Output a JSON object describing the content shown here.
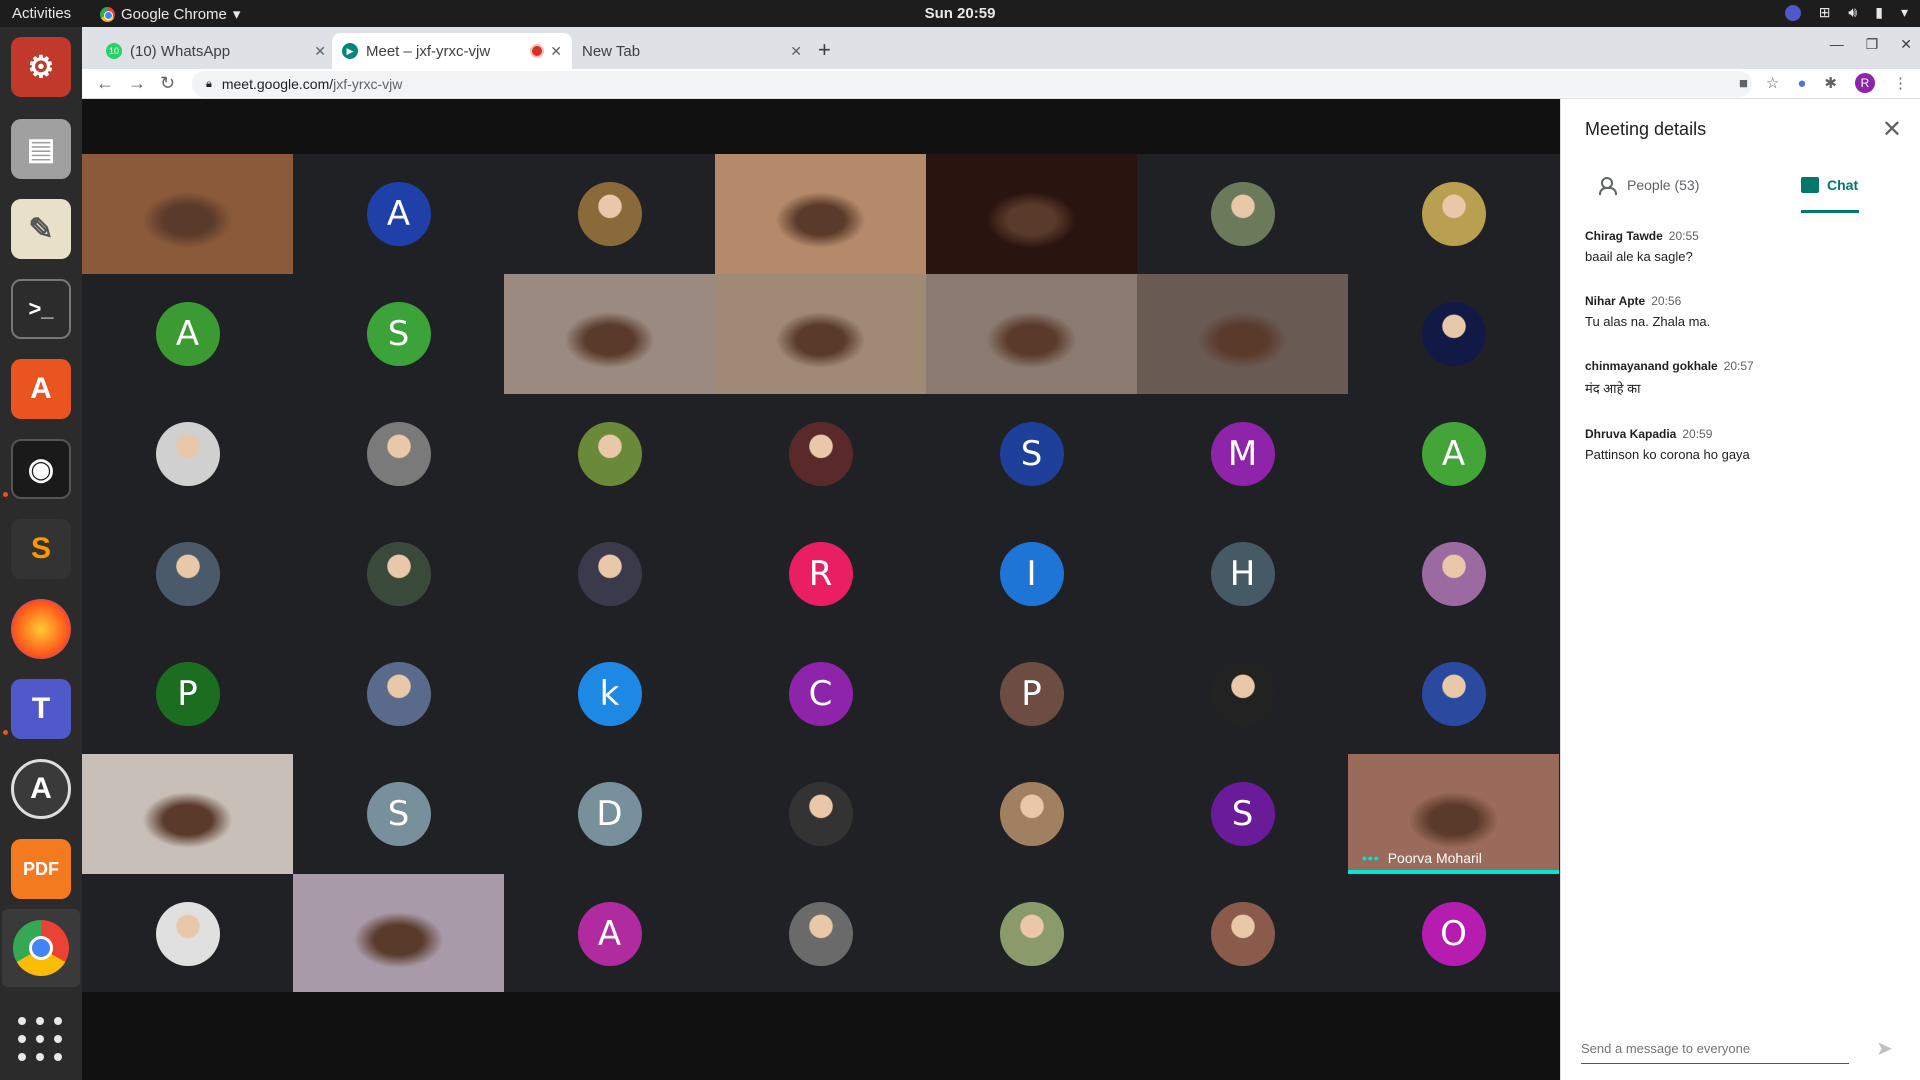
{
  "system": {
    "activities": "Activities",
    "app_name": "Google Chrome",
    "clock": "Sun 20:59"
  },
  "browser": {
    "tabs": [
      {
        "title": "(10) WhatsApp",
        "favicon": "whatsapp-icon"
      },
      {
        "title": "Meet – jxf-yrxc-vjw",
        "favicon": "meet-icon",
        "recording": true
      },
      {
        "title": "New Tab",
        "favicon": ""
      }
    ],
    "url_host": "meet.google.com/",
    "url_path": "jxf-yrxc-vjw",
    "profile_initial": "R"
  },
  "meet": {
    "tiles": [
      {
        "kind": "video",
        "name": "",
        "color": "#8a5a3a"
      },
      {
        "kind": "initial",
        "letter": "A",
        "color": "#1e40a8"
      },
      {
        "kind": "photo",
        "color": "#8a6a3a"
      },
      {
        "kind": "video",
        "name": "",
        "color": "#b48a6a"
      },
      {
        "kind": "video",
        "name": "",
        "color": "#2a1410"
      },
      {
        "kind": "photo",
        "color": "#6a7a5a"
      },
      {
        "kind": "photo",
        "color": "#b8a050"
      },
      {
        "kind": "initial",
        "letter": "A",
        "color": "#3c9a33"
      },
      {
        "kind": "initial",
        "letter": "S",
        "color": "#3ba33a"
      },
      {
        "kind": "video",
        "name": "",
        "color": "#9a8a80"
      },
      {
        "kind": "video",
        "name": "",
        "color": "#a08a76"
      },
      {
        "kind": "video",
        "name": "",
        "color": "#8a7a70"
      },
      {
        "kind": "video",
        "name": "",
        "color": "#6a5a54"
      },
      {
        "kind": "photo",
        "color": "#111a44"
      },
      {
        "kind": "photo",
        "color": "#d0d0d0"
      },
      {
        "kind": "photo",
        "color": "#7a7a7a"
      },
      {
        "kind": "photo",
        "color": "#6a8a3a"
      },
      {
        "kind": "photo",
        "color": "#5a2a2a"
      },
      {
        "kind": "initial",
        "letter": "S",
        "color": "#1e3f9a"
      },
      {
        "kind": "initial",
        "letter": "M",
        "color": "#8e24aa"
      },
      {
        "kind": "initial",
        "letter": "A",
        "color": "#43a437"
      },
      {
        "kind": "photo",
        "color": "#4a5a6a"
      },
      {
        "kind": "photo",
        "color": "#3a4a3a"
      },
      {
        "kind": "photo",
        "color": "#3a3a4a"
      },
      {
        "kind": "initial",
        "letter": "R",
        "color": "#e91e63"
      },
      {
        "kind": "initial",
        "letter": "I",
        "color": "#1e75d6"
      },
      {
        "kind": "initial",
        "letter": "H",
        "color": "#455a64"
      },
      {
        "kind": "photo",
        "color": "#9a6aa0"
      },
      {
        "kind": "initial",
        "letter": "P",
        "color": "#1b6e1f"
      },
      {
        "kind": "photo",
        "color": "#5a6a8a"
      },
      {
        "kind": "initial",
        "letter": "k",
        "color": "#1e88e5"
      },
      {
        "kind": "initial",
        "letter": "C",
        "color": "#8e24aa"
      },
      {
        "kind": "initial",
        "letter": "P",
        "color": "#6d4c41"
      },
      {
        "kind": "photo",
        "color": "#222222"
      },
      {
        "kind": "photo",
        "color": "#2a4aa0"
      },
      {
        "kind": "video",
        "name": "",
        "color": "#c8c0b8"
      },
      {
        "kind": "initial",
        "letter": "S",
        "color": "#78909c"
      },
      {
        "kind": "initial",
        "letter": "D",
        "color": "#78909c"
      },
      {
        "kind": "photo",
        "color": "#333333"
      },
      {
        "kind": "photo",
        "color": "#a08060"
      },
      {
        "kind": "initial",
        "letter": "S",
        "color": "#6a1b9a"
      },
      {
        "kind": "video",
        "name": "Poorva Moharil",
        "color": "#9a6a5a",
        "speaking": true
      },
      {
        "kind": "photo",
        "color": "#e0e0e0"
      },
      {
        "kind": "video",
        "name": "",
        "color": "#a89aa8"
      },
      {
        "kind": "initial",
        "letter": "A",
        "color": "#b02aa0"
      },
      {
        "kind": "photo",
        "color": "#6a6a6a"
      },
      {
        "kind": "photo",
        "color": "#8a9a6a"
      },
      {
        "kind": "photo",
        "color": "#8a5a4a"
      },
      {
        "kind": "initial",
        "letter": "O",
        "color": "#b71cb0"
      }
    ]
  },
  "panel": {
    "title": "Meeting details",
    "people_tab": "People (53)",
    "chat_tab": "Chat",
    "messages": [
      {
        "sender": "Chirag Tawde",
        "time": "20:55",
        "text": "baail ale ka sagle?"
      },
      {
        "sender": "Nihar Apte",
        "time": "20:56",
        "text": "Tu alas na. Zhala ma."
      },
      {
        "sender": "chinmayanand gokhale",
        "time": "20:57",
        "text": "मंद आहे का"
      },
      {
        "sender": "Dhruva Kapadia",
        "time": "20:59",
        "text": "Pattinson ko corona ho gaya"
      }
    ],
    "input_placeholder": "Send a message to everyone"
  },
  "dock": {
    "items": [
      "settings-icon",
      "files-icon",
      "text-editor-icon",
      "terminal-icon",
      "software-icon",
      "safe-icon",
      "sublime-icon",
      "firefox-icon",
      "teams-icon",
      "updater-icon",
      "pdf-icon",
      "chrome-icon"
    ],
    "colors": [
      "#d04a2a",
      "#b0b0b0",
      "#f0e8d0",
      "#2a2a2a",
      "#e95420",
      "#222222",
      "#ff9800",
      "#ff7a1a",
      "#5059c9",
      "#3a3a3a",
      "#f47a20",
      "#4285f4"
    ]
  }
}
